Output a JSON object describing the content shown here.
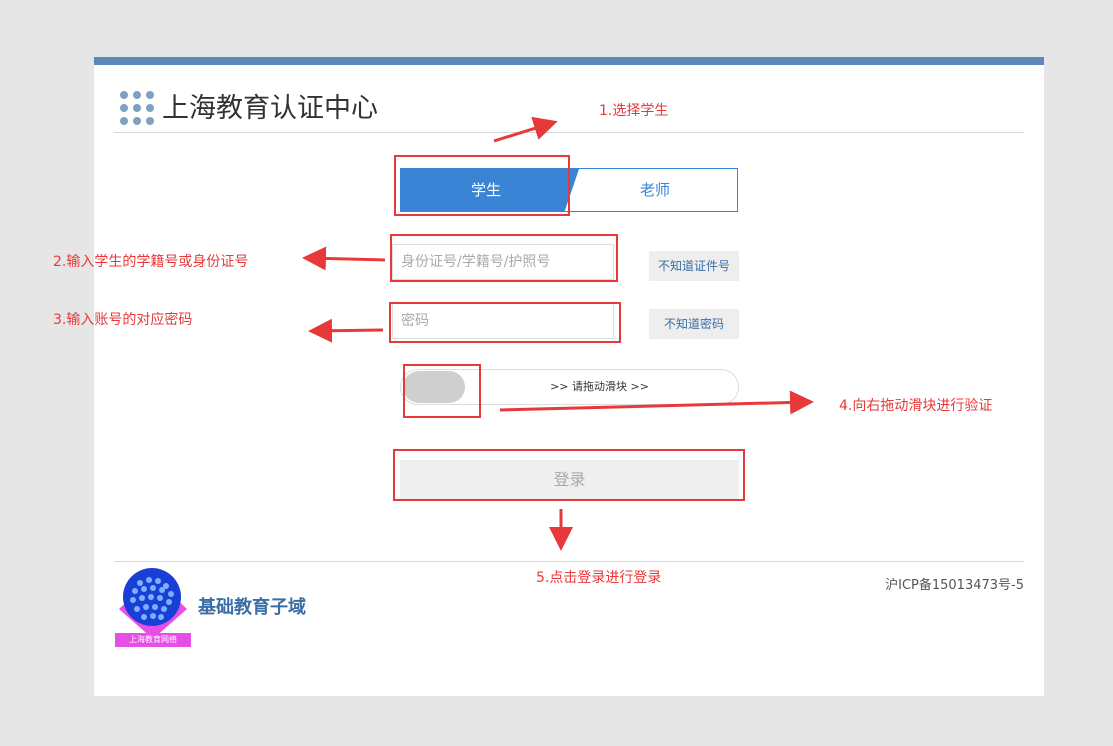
{
  "header": {
    "title": "上海教育认证中心"
  },
  "tabs": [
    {
      "label": "学生",
      "active": true
    },
    {
      "label": "老师",
      "active": false
    }
  ],
  "form": {
    "id_placeholder": "身份证号/学籍号/护照号",
    "password_placeholder": "密码",
    "forgot_id_label": "不知道证件号",
    "forgot_password_label": "不知道密码",
    "slider_text": ">> 请拖动滑块 >>",
    "login_label": "登录"
  },
  "footer": {
    "logo_caption": "上海教育网络",
    "domain_label": "基础教育子域",
    "icp": "沪ICP备15013473号-5"
  },
  "annotations": [
    {
      "text": "1.选择学生"
    },
    {
      "text": "2.输入学生的学籍号或身份证号"
    },
    {
      "text": "3.输入账号的对应密码"
    },
    {
      "text": "4.向右拖动滑块进行验证"
    },
    {
      "text": "5.点击登录进行登录"
    }
  ],
  "colors": {
    "accent": "#3a84d6",
    "top_bar": "#5b87b9",
    "annotation": "#e8393a",
    "background": "#e6e6e6"
  }
}
